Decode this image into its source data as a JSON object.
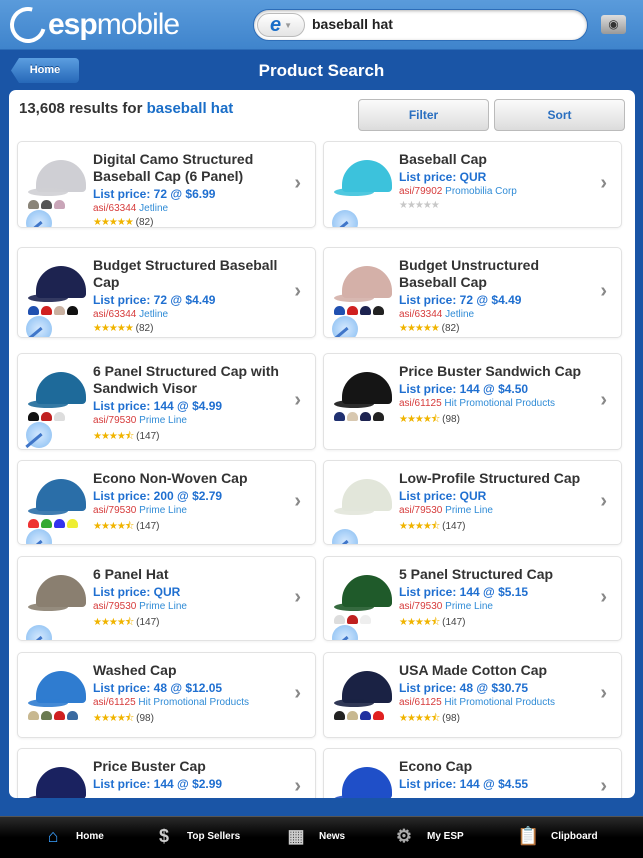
{
  "header": {
    "logo_text_bold": "esp",
    "logo_text": "mobile",
    "search_value": "baseball hat",
    "search_scope_icon": "esp-e-logo",
    "camera_icon": "camera-icon"
  },
  "nav": {
    "back_label": "Home",
    "title": "Product Search"
  },
  "results": {
    "count": "13,608",
    "label": "results for",
    "query": "baseball hat"
  },
  "toolbar": {
    "filter_label": "Filter",
    "sort_label": "Sort"
  },
  "products": [
    {
      "name": "Digital Camo Structured Baseball Cap (6 Panel)",
      "price": "List price: 72 @ $6.99",
      "asi": "asi/63344",
      "supplier": "Jetline",
      "rating": 5,
      "reviews": "(82)",
      "cap_color": "#cfcfd4",
      "swatches": [
        "#8a8478",
        "#555",
        "#c9a5b8"
      ]
    },
    {
      "name": "Baseball Cap",
      "price": "List price: QUR",
      "asi": "asi/79902",
      "supplier": "Promobilia Corp",
      "rating": 0,
      "reviews": "",
      "cap_color": "#3cc2dc",
      "swatches": []
    },
    {
      "name": "Budget Structured Baseball Cap",
      "price": "List price: 72 @ $4.49",
      "asi": "asi/63344",
      "supplier": "Jetline",
      "rating": 5,
      "reviews": "(82)",
      "cap_color": "#1d2350",
      "swatches": [
        "#2050b0",
        "#d02020",
        "#c9b0a0",
        "#111"
      ]
    },
    {
      "name": "Budget Unstructured Baseball Cap",
      "price": "List price: 72 @ $4.49",
      "asi": "asi/63344",
      "supplier": "Jetline",
      "rating": 5,
      "reviews": "(82)",
      "cap_color": "#d4b0a8",
      "swatches": [
        "#2050b0",
        "#d02020",
        "#1d2350",
        "#222"
      ]
    },
    {
      "name": "6 Panel Structured Cap with Sandwich Visor",
      "price": "List price: 144 @ $4.99",
      "asi": "asi/79530",
      "supplier": "Prime Line",
      "rating": 4.5,
      "reviews": "(147)",
      "cap_color": "#1e6a9a",
      "swatches": [
        "#111",
        "#c02020",
        "#ddd"
      ]
    },
    {
      "name": "Price Buster Sandwich Cap",
      "price": "List price: 144 @ $4.50",
      "asi": "asi/61125",
      "supplier": "Hit Promotional Products",
      "rating": 4.5,
      "reviews": "(98)",
      "cap_color": "#151515",
      "swatches": [
        "#203070",
        "#d8c8b0",
        "#1d2350",
        "#222"
      ]
    },
    {
      "name": "Econo Non-Woven Cap",
      "price": "List price: 200 @ $2.79",
      "asi": "asi/79530",
      "supplier": "Prime Line",
      "rating": 4.5,
      "reviews": "(147)",
      "cap_color": "#2a6ea8",
      "swatches": [
        "#e33",
        "#3a3",
        "#33e",
        "#ee3"
      ]
    },
    {
      "name": "Low-Profile Structured Cap",
      "price": "List price: QUR",
      "asi": "asi/79530",
      "supplier": "Prime Line",
      "rating": 4.5,
      "reviews": "(147)",
      "cap_color": "#e2e6da",
      "swatches": []
    },
    {
      "name": "6 Panel Hat",
      "price": "List price: QUR",
      "asi": "asi/79530",
      "supplier": "Prime Line",
      "rating": 4.5,
      "reviews": "(147)",
      "cap_color": "#8a7f70",
      "swatches": []
    },
    {
      "name": "5 Panel Structured Cap",
      "price": "List price: 144 @ $5.15",
      "asi": "asi/79530",
      "supplier": "Prime Line",
      "rating": 4.5,
      "reviews": "(147)",
      "cap_color": "#1f5a2a",
      "swatches": [
        "#ddd",
        "#c02020",
        "#eee"
      ]
    },
    {
      "name": "Washed Cap",
      "price": "List price: 48 @ $12.05",
      "asi": "asi/61125",
      "supplier": "Hit Promotional Products",
      "rating": 4.5,
      "reviews": "(98)",
      "cap_color": "#2f7cd0",
      "swatches": [
        "#c8b890",
        "#6a7a50",
        "#d02020",
        "#3a6aa0"
      ]
    },
    {
      "name": "USA Made Cotton Cap",
      "price": "List price: 48 @ $30.75",
      "asi": "asi/61125",
      "supplier": "Hit Promotional Products",
      "rating": 4.5,
      "reviews": "(98)",
      "cap_color": "#1a2244",
      "swatches": [
        "#222",
        "#c8b890",
        "#2030a0",
        "#e02020"
      ]
    },
    {
      "name": "Price Buster Cap",
      "price": "List price: 144 @ $2.99",
      "asi": "",
      "supplier": "",
      "rating": null,
      "reviews": "",
      "cap_color": "#1a2260",
      "swatches": []
    },
    {
      "name": "Econo Cap",
      "price": "List price: 144 @ $4.55",
      "asi": "",
      "supplier": "",
      "rating": null,
      "reviews": "",
      "cap_color": "#1f4fc8",
      "swatches": []
    }
  ],
  "tabbar": [
    {
      "label": "Home",
      "icon": "home-icon"
    },
    {
      "label": "Top Sellers",
      "icon": "money-bag-icon"
    },
    {
      "label": "News",
      "icon": "newspaper-icon"
    },
    {
      "label": "My ESP",
      "icon": "gears-icon"
    },
    {
      "label": "Clipboard",
      "icon": "clipboard-icon"
    }
  ],
  "colors": {
    "header": "#4a8fd4",
    "navbar": "#1a55a6",
    "accent": "#1f6fd0",
    "asi": "#d63b3b",
    "supplier": "#2f8bd6",
    "star": "#f0b400"
  }
}
